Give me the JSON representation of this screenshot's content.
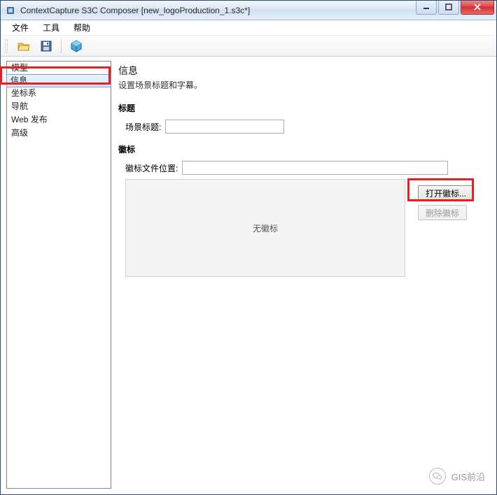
{
  "window": {
    "title": "ContextCapture S3C Composer [new_logoProduction_1.s3c*]"
  },
  "menu": {
    "items": [
      "文件",
      "工具",
      "帮助"
    ]
  },
  "sidebar": {
    "items": [
      "模型",
      "信息",
      "坐标系",
      "导航",
      "Web 发布",
      "高级"
    ],
    "selected_index": 1
  },
  "info": {
    "heading": "信息",
    "description": "设置场景标题和字幕。",
    "section_title": "标题",
    "scene_title_label": "场景标题:",
    "scene_title_value": "",
    "section_logo": "徽标",
    "logo_path_label": "徽标文件位置:",
    "logo_path_value": "",
    "open_logo_btn": "打开徽标...",
    "delete_logo_btn": "删除徽标",
    "no_logo_text": "无徽标"
  },
  "watermark": {
    "label": "GIS前沿"
  }
}
